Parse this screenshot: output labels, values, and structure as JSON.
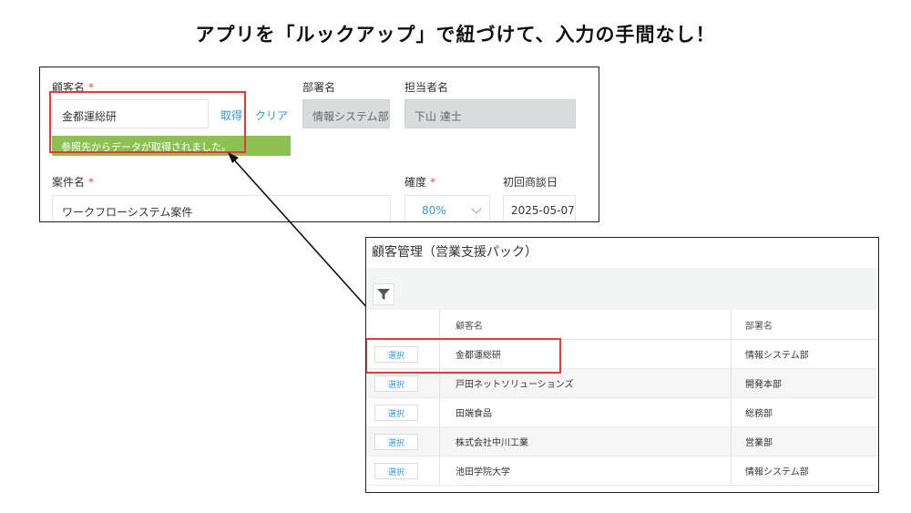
{
  "headline": "アプリを「ルックアップ」で紐づけて、入力の手間なし！",
  "form": {
    "customer_label": "顧客名",
    "required_mark": "*",
    "customer_value": "金都運総研",
    "fetch_link": "取得",
    "clear_link": "クリア",
    "department_label": "部署名",
    "department_value": "情報システム部",
    "person_label": "担当者名",
    "person_value": "下山 達士",
    "notice": "参照先からデータが取得されました。",
    "project_label": "案件名",
    "project_value": "ワークフローシステム案件",
    "certainty_label": "確度",
    "certainty_value": "80%",
    "first_meeting_label": "初回商談日",
    "first_meeting_value": "2025-05-07"
  },
  "lookup": {
    "title": "顧客管理（営業支援パック）",
    "filter_icon": "filter-icon",
    "columns": [
      "顧客名",
      "部署名"
    ],
    "select_label": "選択",
    "rows": [
      {
        "customer": "金都運総研",
        "department": "情報システム部"
      },
      {
        "customer": "戸田ネットソリューションズ",
        "department": "開発本部"
      },
      {
        "customer": "田端食品",
        "department": "総務部"
      },
      {
        "customer": "株式会社中川工業",
        "department": "営業部"
      },
      {
        "customer": "池田学院大学",
        "department": "情報システム部"
      }
    ]
  },
  "colors": {
    "highlight": "#e33b3b",
    "notice_bg": "#8cc152",
    "link": "#3498db",
    "required": "#e74c3c"
  }
}
